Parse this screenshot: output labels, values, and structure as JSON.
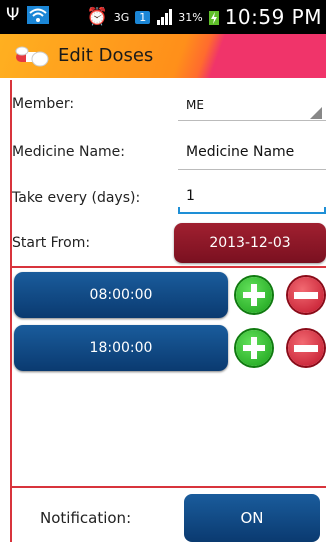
{
  "status_bar": {
    "signal_3g": "3G",
    "sim_badge": "1",
    "battery_percent": "31%",
    "time": "10:59 PM"
  },
  "header": {
    "title": "Edit Doses",
    "icon": "pills-icon"
  },
  "form": {
    "member_label": "Member:",
    "member_value": "ME",
    "medicine_label": "Medicine Name:",
    "medicine_value": "Medicine Name",
    "take_every_label": "Take every (days):",
    "take_every_value": "1",
    "start_from_label": "Start From:",
    "start_from_value": "2013-12-03"
  },
  "doses": [
    {
      "time": "08:00:00"
    },
    {
      "time": "18:00:00"
    }
  ],
  "notification": {
    "label": "Notification:",
    "toggle": "ON"
  },
  "colors": {
    "accent_red": "#d8343c",
    "button_blue": "#0a3a70",
    "date_red": "#8a1626",
    "plus_green": "#1aa11a",
    "minus_red": "#c0142a"
  }
}
